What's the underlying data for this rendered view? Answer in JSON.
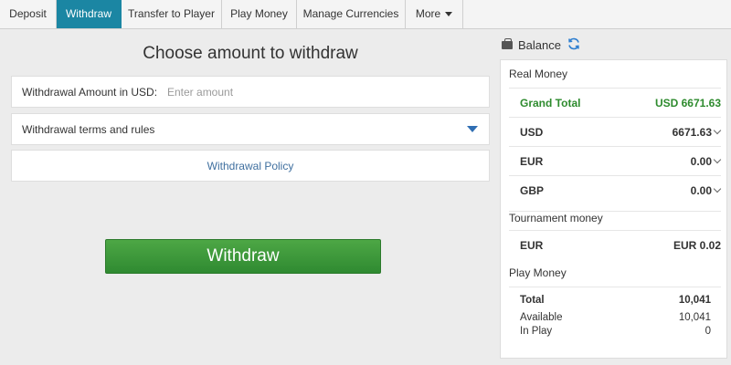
{
  "tabs": [
    {
      "label": "Deposit"
    },
    {
      "label": "Withdraw"
    },
    {
      "label": "Transfer to Player"
    },
    {
      "label": "Play Money"
    },
    {
      "label": "Manage Currencies"
    },
    {
      "label": "More"
    }
  ],
  "withdraw": {
    "title": "Choose amount to withdraw",
    "amount_label": "Withdrawal Amount in USD:",
    "amount_placeholder": "Enter amount",
    "terms_label": "Withdrawal terms and rules",
    "policy_link": "Withdrawal Policy",
    "button_label": "Withdraw"
  },
  "balance": {
    "title": "Balance",
    "real_money": {
      "title": "Real Money",
      "grand_total_label": "Grand Total",
      "grand_total_value": "USD 6671.63",
      "rows": [
        {
          "currency": "USD",
          "amount": "6671.63"
        },
        {
          "currency": "EUR",
          "amount": "0.00"
        },
        {
          "currency": "GBP",
          "amount": "0.00"
        }
      ]
    },
    "tournament": {
      "title": "Tournament money",
      "currency": "EUR",
      "amount": "EUR 0.02"
    },
    "play_money": {
      "title": "Play Money",
      "total_label": "Total",
      "total_value": "10,041",
      "available_label": "Available",
      "available_value": "10,041",
      "in_play_label": "In Play",
      "in_play_value": "0"
    }
  },
  "colors": {
    "active_tab": "#1b86a3",
    "button_green": "#3a9a3a",
    "grand_total": "#2e8b2e",
    "link": "#3f6f9f"
  },
  "icons": {
    "wallet": "wallet-icon",
    "refresh": "refresh-icon",
    "caret": "chevron-down-icon"
  }
}
